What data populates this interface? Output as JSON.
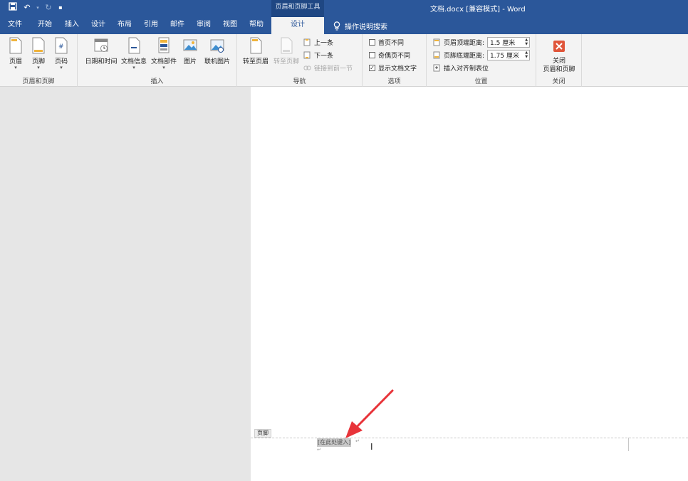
{
  "title_bar": {
    "context_tab_title": "页眉和页脚工具",
    "document_title": "文档.docx [兼容模式] - Word",
    "qat": [
      "save-icon",
      "undo-icon",
      "redo-icon",
      "customize-icon"
    ]
  },
  "tabs": [
    {
      "label": "文件"
    },
    {
      "label": "开始"
    },
    {
      "label": "插入"
    },
    {
      "label": "设计"
    },
    {
      "label": "布局"
    },
    {
      "label": "引用"
    },
    {
      "label": "邮件"
    },
    {
      "label": "审阅"
    },
    {
      "label": "视图"
    },
    {
      "label": "帮助"
    },
    {
      "label": "设计"
    }
  ],
  "tell_me": "操作说明搜索",
  "ribbon": {
    "group_header_footer": {
      "label": "页眉和页脚",
      "buttons": [
        "页眉",
        "页脚",
        "页码"
      ]
    },
    "group_insert": {
      "label": "插入",
      "buttons": [
        "日期和时间",
        "文档信息",
        "文档部件",
        "图片",
        "联机图片"
      ]
    },
    "group_nav": {
      "label": "导航",
      "goto_header": "转至页眉",
      "goto_footer": "转至页脚",
      "previous": "上一条",
      "next": "下一条",
      "link_previous": "链接到前一节"
    },
    "group_options": {
      "label": "选项",
      "first_page": "首页不同",
      "odd_even": "奇偶页不同",
      "show_text": "显示文档文字"
    },
    "group_position": {
      "label": "位置",
      "header_top_label": "页眉顶端距离:",
      "header_top_value": "1.5 厘米",
      "footer_bottom_label": "页脚底端距离:",
      "footer_bottom_value": "1.75 厘米",
      "insert_align_tab": "插入对齐制表位"
    },
    "group_close": {
      "label": "关闭",
      "close_line1": "关闭",
      "close_line2": "页眉和页脚"
    }
  },
  "document": {
    "footer_tag": "页脚",
    "placeholder": "[在此处键入]"
  },
  "colors": {
    "title_blue": "#2b579a",
    "annotation_arrow": "#e8343a",
    "close_red": "#e0553a"
  }
}
